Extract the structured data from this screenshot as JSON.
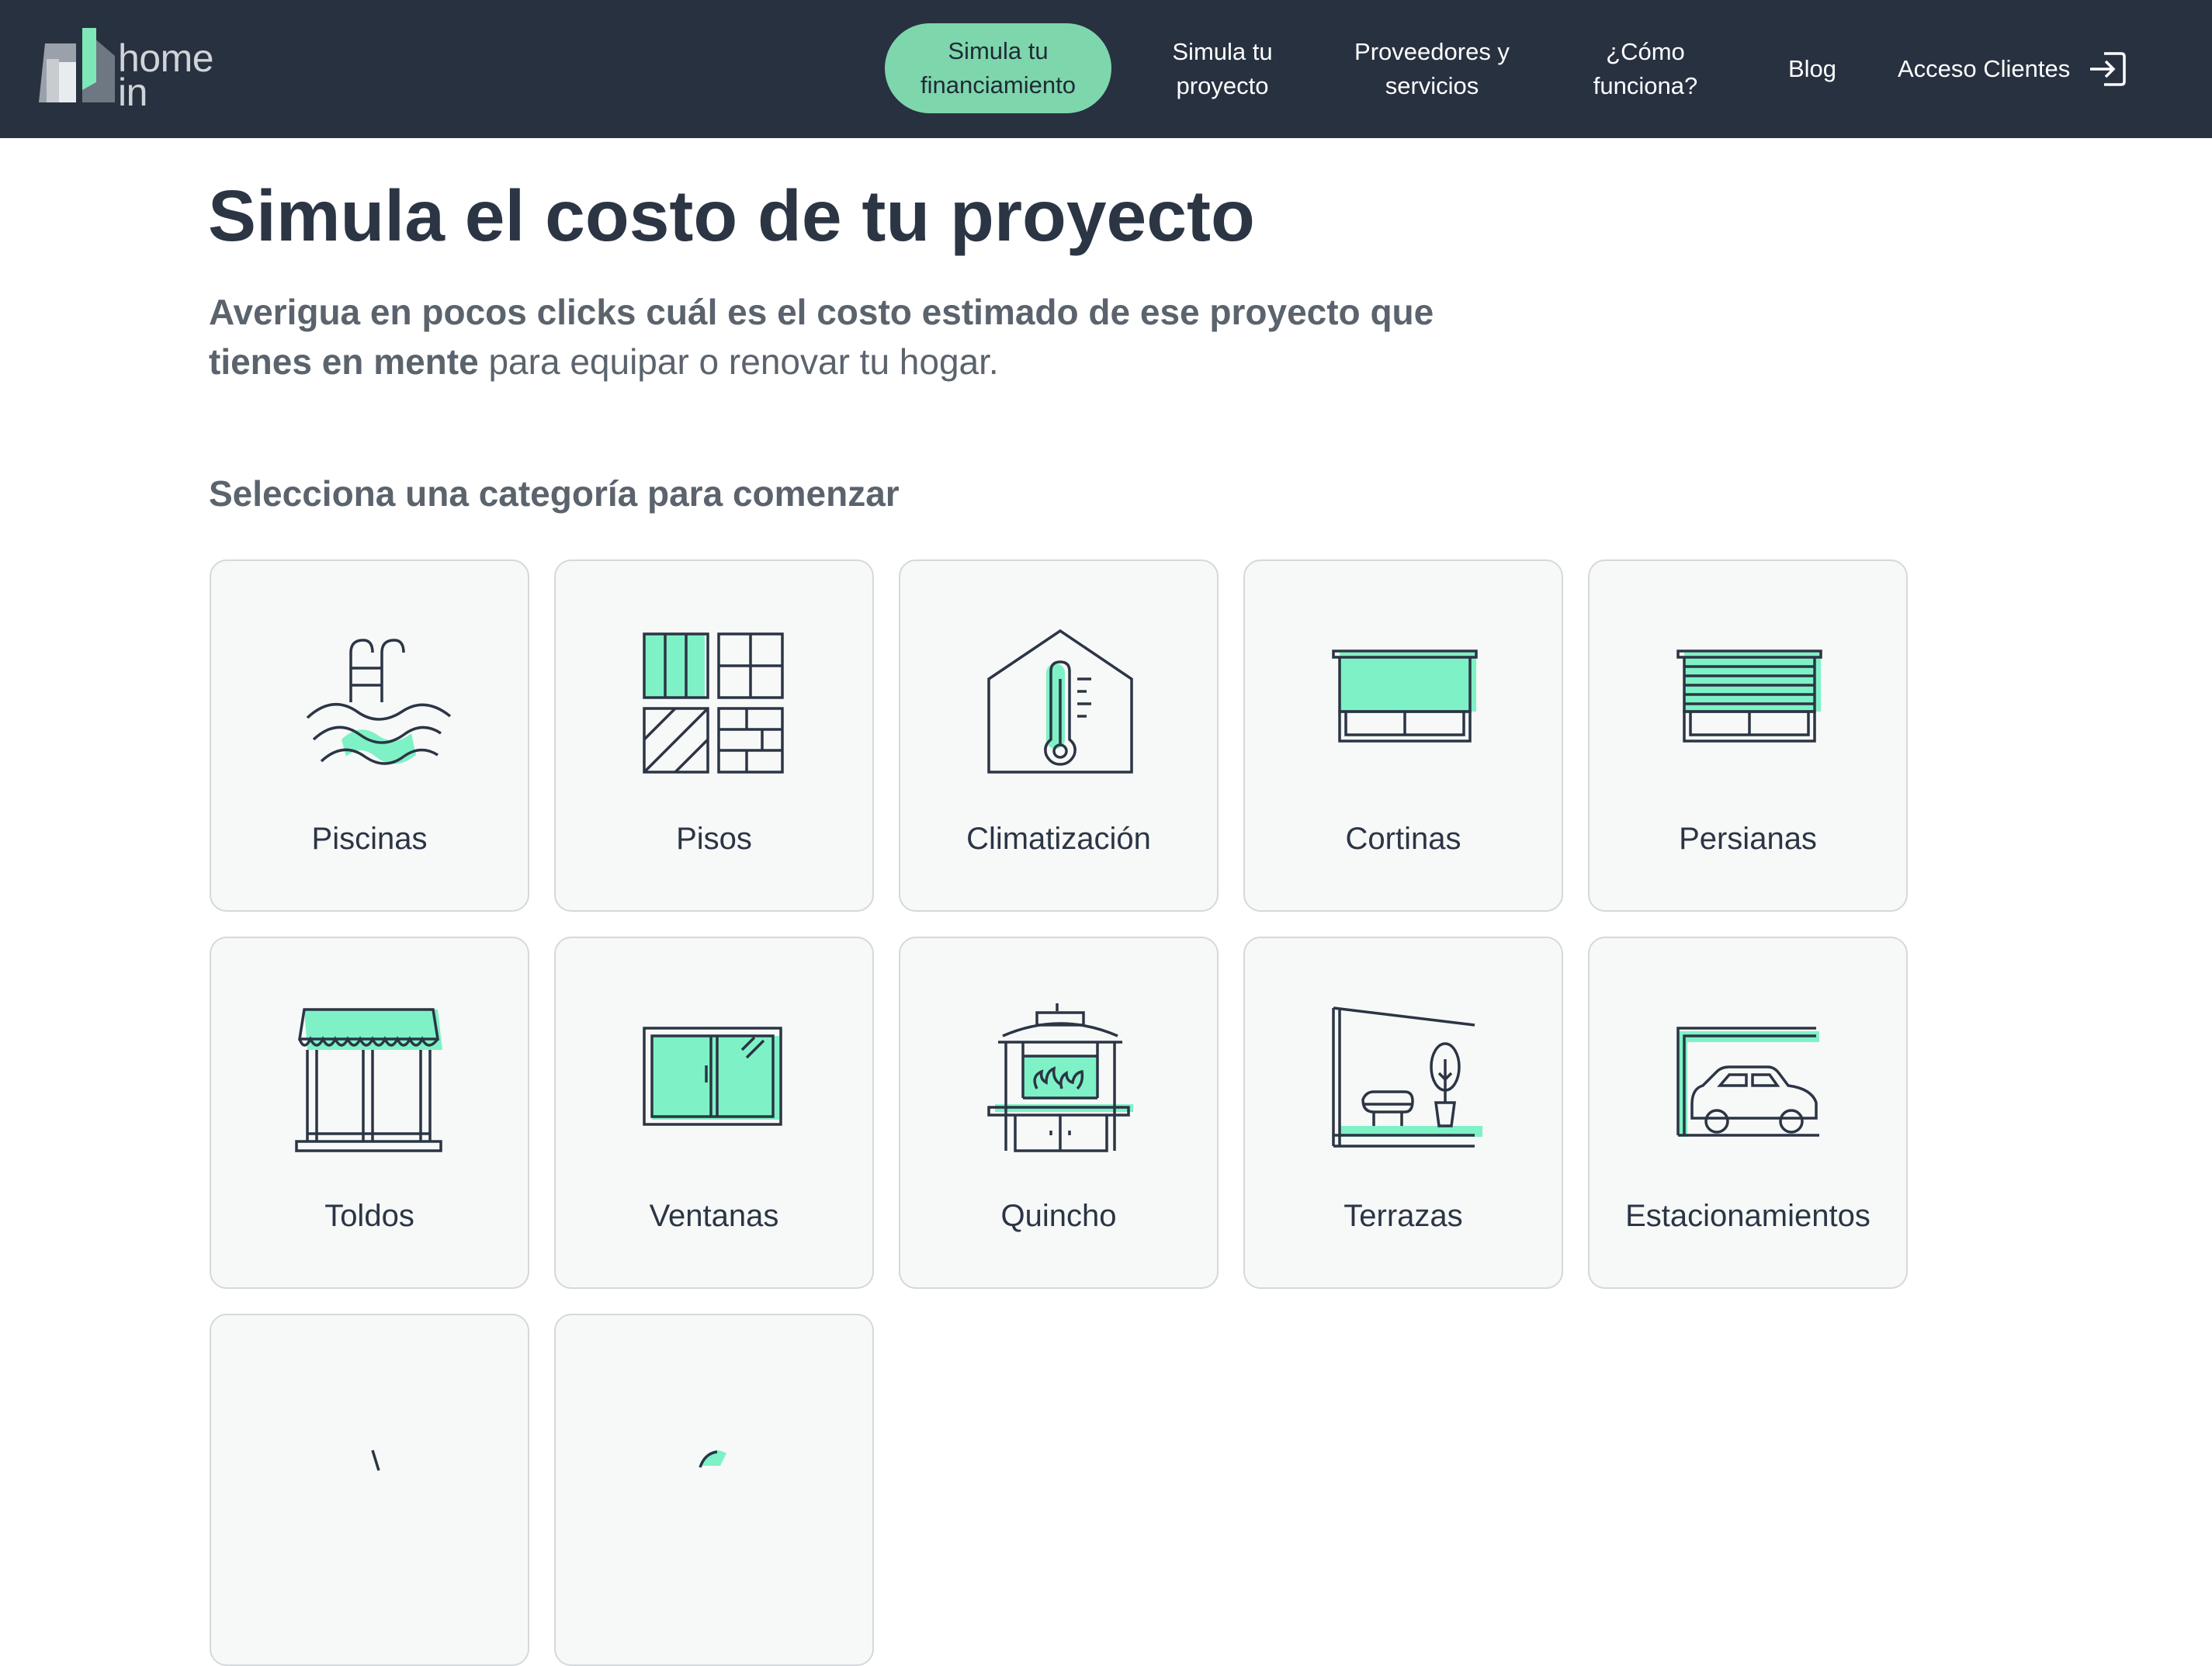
{
  "brand": {
    "logo_text_line1": "home",
    "logo_text_line2": "in",
    "accent_color": "#7ed6ac",
    "header_bg": "#283140"
  },
  "nav": {
    "financing": "Simula tu financiamiento",
    "project": "Simula tu proyecto",
    "providers": "Proveedores y servicios",
    "how": "¿Cómo funciona?",
    "blog": "Blog",
    "login": "Acceso Clientes",
    "login_icon": "login-arrow-icon"
  },
  "main": {
    "title": "Simula el costo de tu proyecto",
    "intro_bold": "Averigua en pocos clicks cuál es el costo estimado de ese proyecto que tienes en mente",
    "intro_rest": " para equipar o renovar tu hogar.",
    "section_label": "Selecciona una categoría para comenzar"
  },
  "categories": [
    {
      "label": "Piscinas",
      "icon": "pool-icon"
    },
    {
      "label": "Pisos",
      "icon": "floor-tiles-icon"
    },
    {
      "label": "Climatización",
      "icon": "thermometer-house-icon"
    },
    {
      "label": "Cortinas",
      "icon": "curtain-window-icon"
    },
    {
      "label": "Persianas",
      "icon": "blinds-window-icon"
    },
    {
      "label": "Toldos",
      "icon": "awning-icon"
    },
    {
      "label": "Ventanas",
      "icon": "sliding-window-icon"
    },
    {
      "label": "Quincho",
      "icon": "bbq-grill-icon"
    },
    {
      "label": "Terrazas",
      "icon": "terrace-icon"
    },
    {
      "label": "Estacionamientos",
      "icon": "carport-icon"
    },
    {
      "label": "",
      "icon": "category-icon"
    },
    {
      "label": "",
      "icon": "category-icon"
    }
  ]
}
